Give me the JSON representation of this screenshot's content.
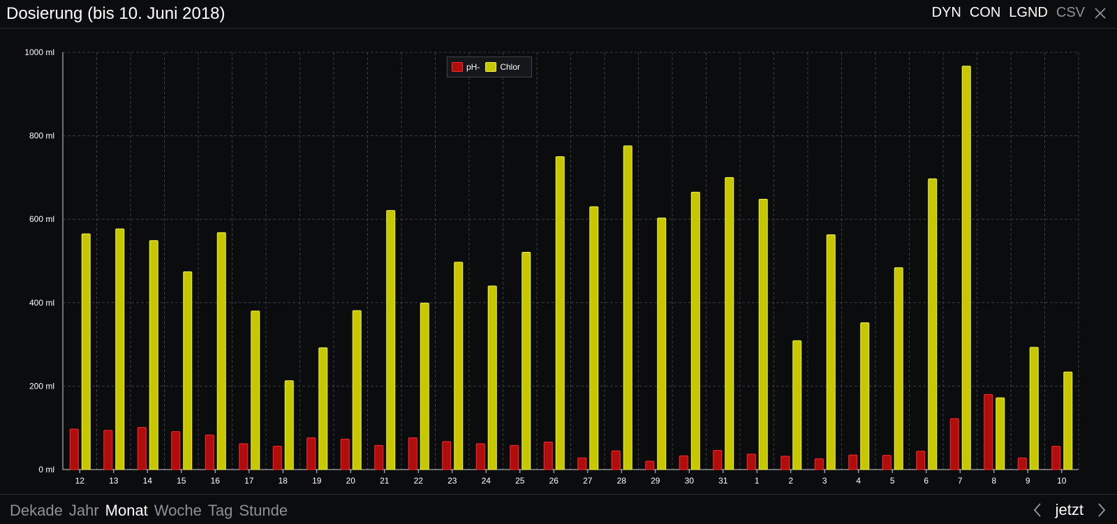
{
  "header": {
    "title": "Dosierung (bis 10. Juni 2018)",
    "actions": [
      "DYN",
      "CON",
      "LGND",
      "CSV"
    ]
  },
  "footer": {
    "ranges": [
      "Dekade",
      "Jahr",
      "Monat",
      "Woche",
      "Tag",
      "Stunde"
    ],
    "active_range": "Monat",
    "now_label": "jetzt"
  },
  "colors": {
    "ph_fill": "#b00d0d",
    "ph_stroke": "#ff2a2a",
    "chlor_fill": "#c7c700",
    "chlor_stroke": "#f2f24a",
    "grid": "#3a3d42",
    "axis_text": "#ffffff"
  },
  "chart_data": {
    "type": "bar",
    "title": "",
    "xlabel": "",
    "ylabel": "",
    "ylim": [
      0,
      1000
    ],
    "yticks": [
      "0 ml",
      "200 ml",
      "400 ml",
      "600 ml",
      "800 ml",
      "1000 ml"
    ],
    "grid": true,
    "legend_position": "top-center",
    "categories": [
      "12",
      "13",
      "14",
      "15",
      "16",
      "17",
      "18",
      "19",
      "20",
      "21",
      "22",
      "23",
      "24",
      "25",
      "26",
      "27",
      "28",
      "29",
      "30",
      "31",
      "1",
      "2",
      "3",
      "4",
      "5",
      "6",
      "7",
      "8",
      "9",
      "10"
    ],
    "series": [
      {
        "name": "pH-",
        "values": [
          97,
          94,
          101,
          91,
          83,
          62,
          56,
          76,
          73,
          58,
          76,
          67,
          62,
          58,
          66,
          28,
          45,
          20,
          33,
          46,
          37,
          32,
          26,
          35,
          34,
          44,
          122,
          180,
          28,
          56
        ]
      },
      {
        "name": "Chlor",
        "values": [
          565,
          577,
          549,
          474,
          568,
          380,
          213,
          292,
          381,
          621,
          399,
          497,
          440,
          521,
          750,
          630,
          776,
          603,
          665,
          700,
          648,
          309,
          563,
          352,
          484,
          697,
          967,
          172,
          293,
          234
        ]
      }
    ]
  }
}
